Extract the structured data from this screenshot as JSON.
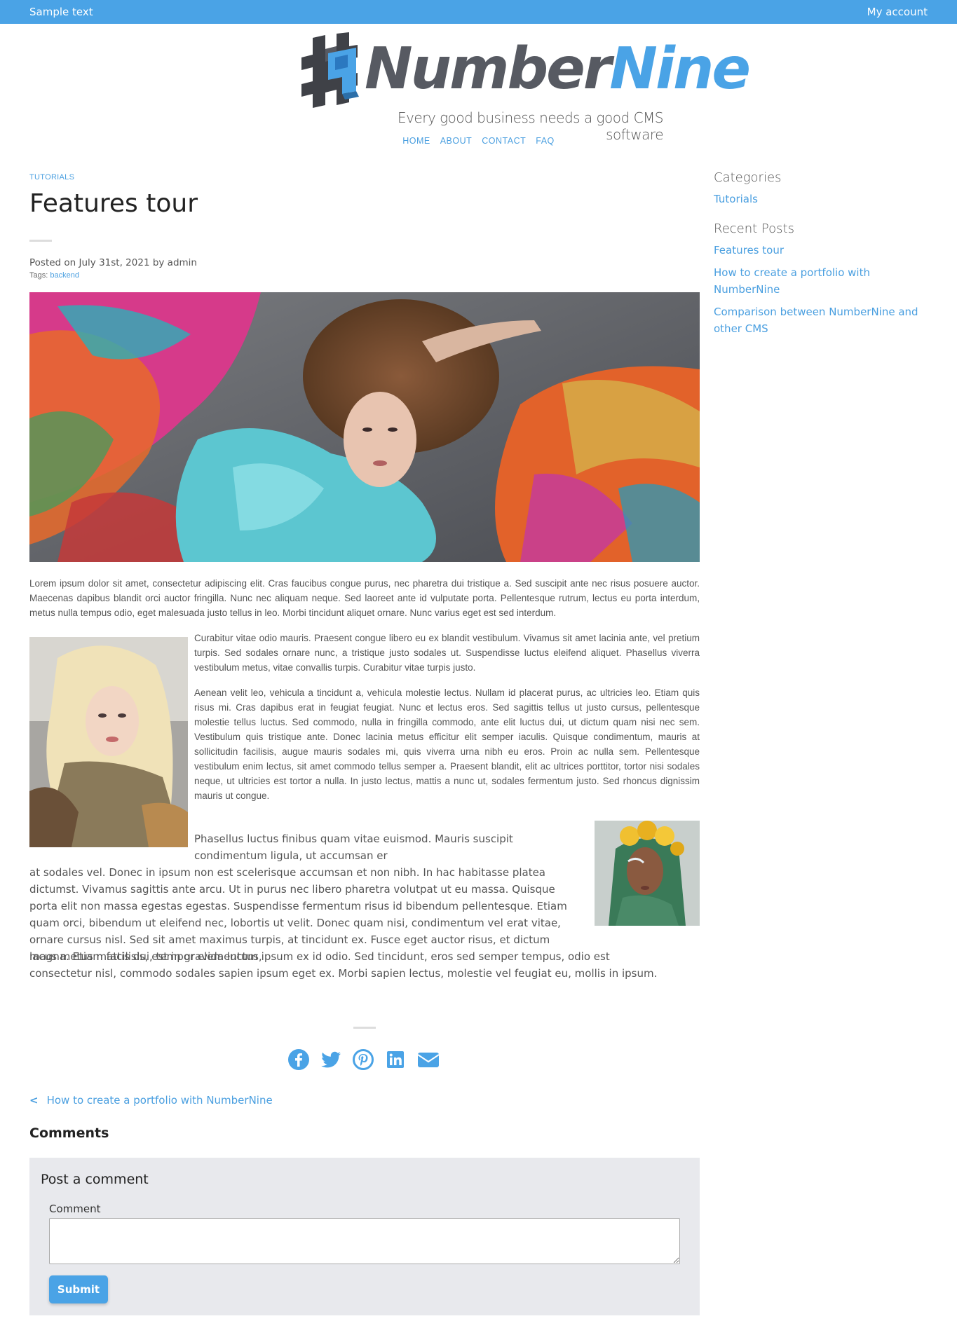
{
  "topbar": {
    "left_text": "Sample text",
    "account_link": "My account"
  },
  "brand": {
    "name_part1": "Number",
    "name_part2": "Nine",
    "tagline": "Every good business needs a good CMS software",
    "colors": {
      "primary": "#4aa3e6",
      "dark": "#575a62"
    }
  },
  "nav": {
    "items": [
      {
        "label": "HOME"
      },
      {
        "label": "ABOUT"
      },
      {
        "label": "CONTACT"
      },
      {
        "label": "FAQ"
      }
    ]
  },
  "post": {
    "category": "TUTORIALS",
    "title": "Features tour",
    "posted_prefix": "Posted on July 31st, 2021 by admin",
    "tags_label": "Tags:",
    "tag": "backend",
    "paragraph1": "Lorem ipsum dolor sit amet, consectetur adipiscing elit. Cras faucibus congue purus, nec pharetra dui tristique a. Sed suscipit ante nec risus posuere auctor. Maecenas dapibus blandit orci auctor fringilla. Nunc nec aliquam neque. Sed laoreet ante id vulputate porta. Pellentesque rutrum, lectus eu porta interdum, metus nulla tempus odio, eget malesuada justo tellus in leo. Morbi tincidunt aliquet ornare. Nunc varius eget est sed interdum.",
    "paragraph2": "Curabitur vitae odio mauris. Praesent congue libero eu ex blandit vestibulum. Vivamus sit amet lacinia ante, vel pretium turpis. Sed sodales ornare nunc, a tristique justo sodales ut. Suspendisse luctus eleifend aliquet. Phasellus viverra vestibulum metus, vitae convallis turpis. Curabitur vitae turpis justo.",
    "paragraph3": "Aenean velit leo, vehicula a tincidunt a, vehicula molestie lectus. Nullam id placerat purus, ac ultricies leo. Etiam quis risus mi. Cras dapibus erat in feugiat feugiat. Nunc et lectus eros. Sed sagittis tellus ut justo cursus, pellentesque molestie tellus luctus. Sed commodo, nulla in fringilla commodo, ante elit luctus dui, ut dictum quam nisi nec sem. Vestibulum quis tristique ante. Donec lacinia metus efficitur elit semper iaculis. Quisque condimentum, mauris at sollicitudin facilisis, augue mauris sodales mi, quis viverra urna nibh eu eros. Proin ac nulla sem. Pellentesque vestibulum enim lectus, sit amet commodo tellus semper a. Praesent blandit, elit ac ultrices porttitor, tortor nisi sodales neque, ut ultricies est tortor a nulla. In justo lectus, mattis a nunc ut, sodales fermentum justo. Sed rhoncus dignissim mauris ut congue.",
    "paragraph4a": "Phasellus luctus finibus quam vitae euismod. Mauris suscipit condimentum ligula, ut accumsan er",
    "paragraph4b": "at sodales vel. Donec in ipsum non est scelerisque accumsan et non nibh. In hac habitasse platea dictumst. Vivamus sagittis ante arcu. Ut in purus nec libero pharetra volutpat ut eu massa. Quisque porta elit non massa egestas egestas. Suspendisse fermentum risus id bibendum pellentesque. Etiam quam orci, bibendum ut eleifend nec, lobortis ut velit. Donec quam nisi, condimentum vel erat vitae, ornare cursus nisl. Sed sit amet maximus turpis, at tincidunt ex. Fusce eget auctor risus, et dictum magna. Etiam facilisis, est in gravida luctus,",
    "paragraph4c": "lacus metus mattis dui, tempor elementum ipsum ex id odio. Sed tincidunt, eros sed semper tempus, odio est consectetur nisl, commodo sodales sapien ipsum eget ex. Morbi sapien lectus, molestie vel feugiat eu, mollis in ipsum."
  },
  "share": {
    "icons": [
      "facebook-icon",
      "twitter-icon",
      "pinterest-icon",
      "linkedin-icon",
      "email-icon"
    ],
    "color": "#4aa3e6"
  },
  "navigation": {
    "prev_chevron": "<",
    "prev_label": "How to create a portfolio with NumberNine"
  },
  "comments": {
    "heading": "Comments",
    "form_title": "Post a comment",
    "comment_label": "Comment",
    "comment_value": "",
    "submit_label": "Submit"
  },
  "sidebar": {
    "categories_heading": "Categories",
    "categories": [
      {
        "label": "Tutorials"
      }
    ],
    "recent_heading": "Recent Posts",
    "recent": [
      {
        "label": "Features tour"
      },
      {
        "label": "How to create a portfolio with NumberNine"
      },
      {
        "label": "Comparison between NumberNine and other CMS"
      }
    ]
  }
}
